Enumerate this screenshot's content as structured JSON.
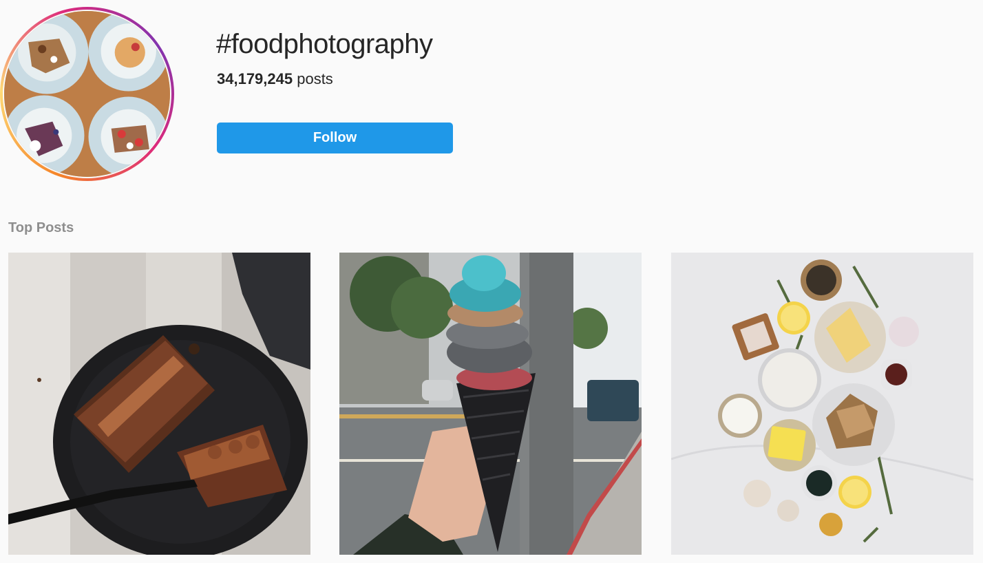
{
  "header": {
    "hashtag": "#foodphotography",
    "post_count": "34,179,245",
    "post_count_suffix": " posts",
    "follow_label": "Follow"
  },
  "top_posts": {
    "heading": "Top Posts",
    "items": [
      {
        "subject": "chocolate cake on black plate"
      },
      {
        "subject": "colorful ice cream in black cone on street"
      },
      {
        "subject": "ingredient flat lay in bowls"
      }
    ]
  },
  "colors": {
    "follow_button": "#1f98e8",
    "background": "#fafafa",
    "heading_gray": "#8e8e8e"
  }
}
